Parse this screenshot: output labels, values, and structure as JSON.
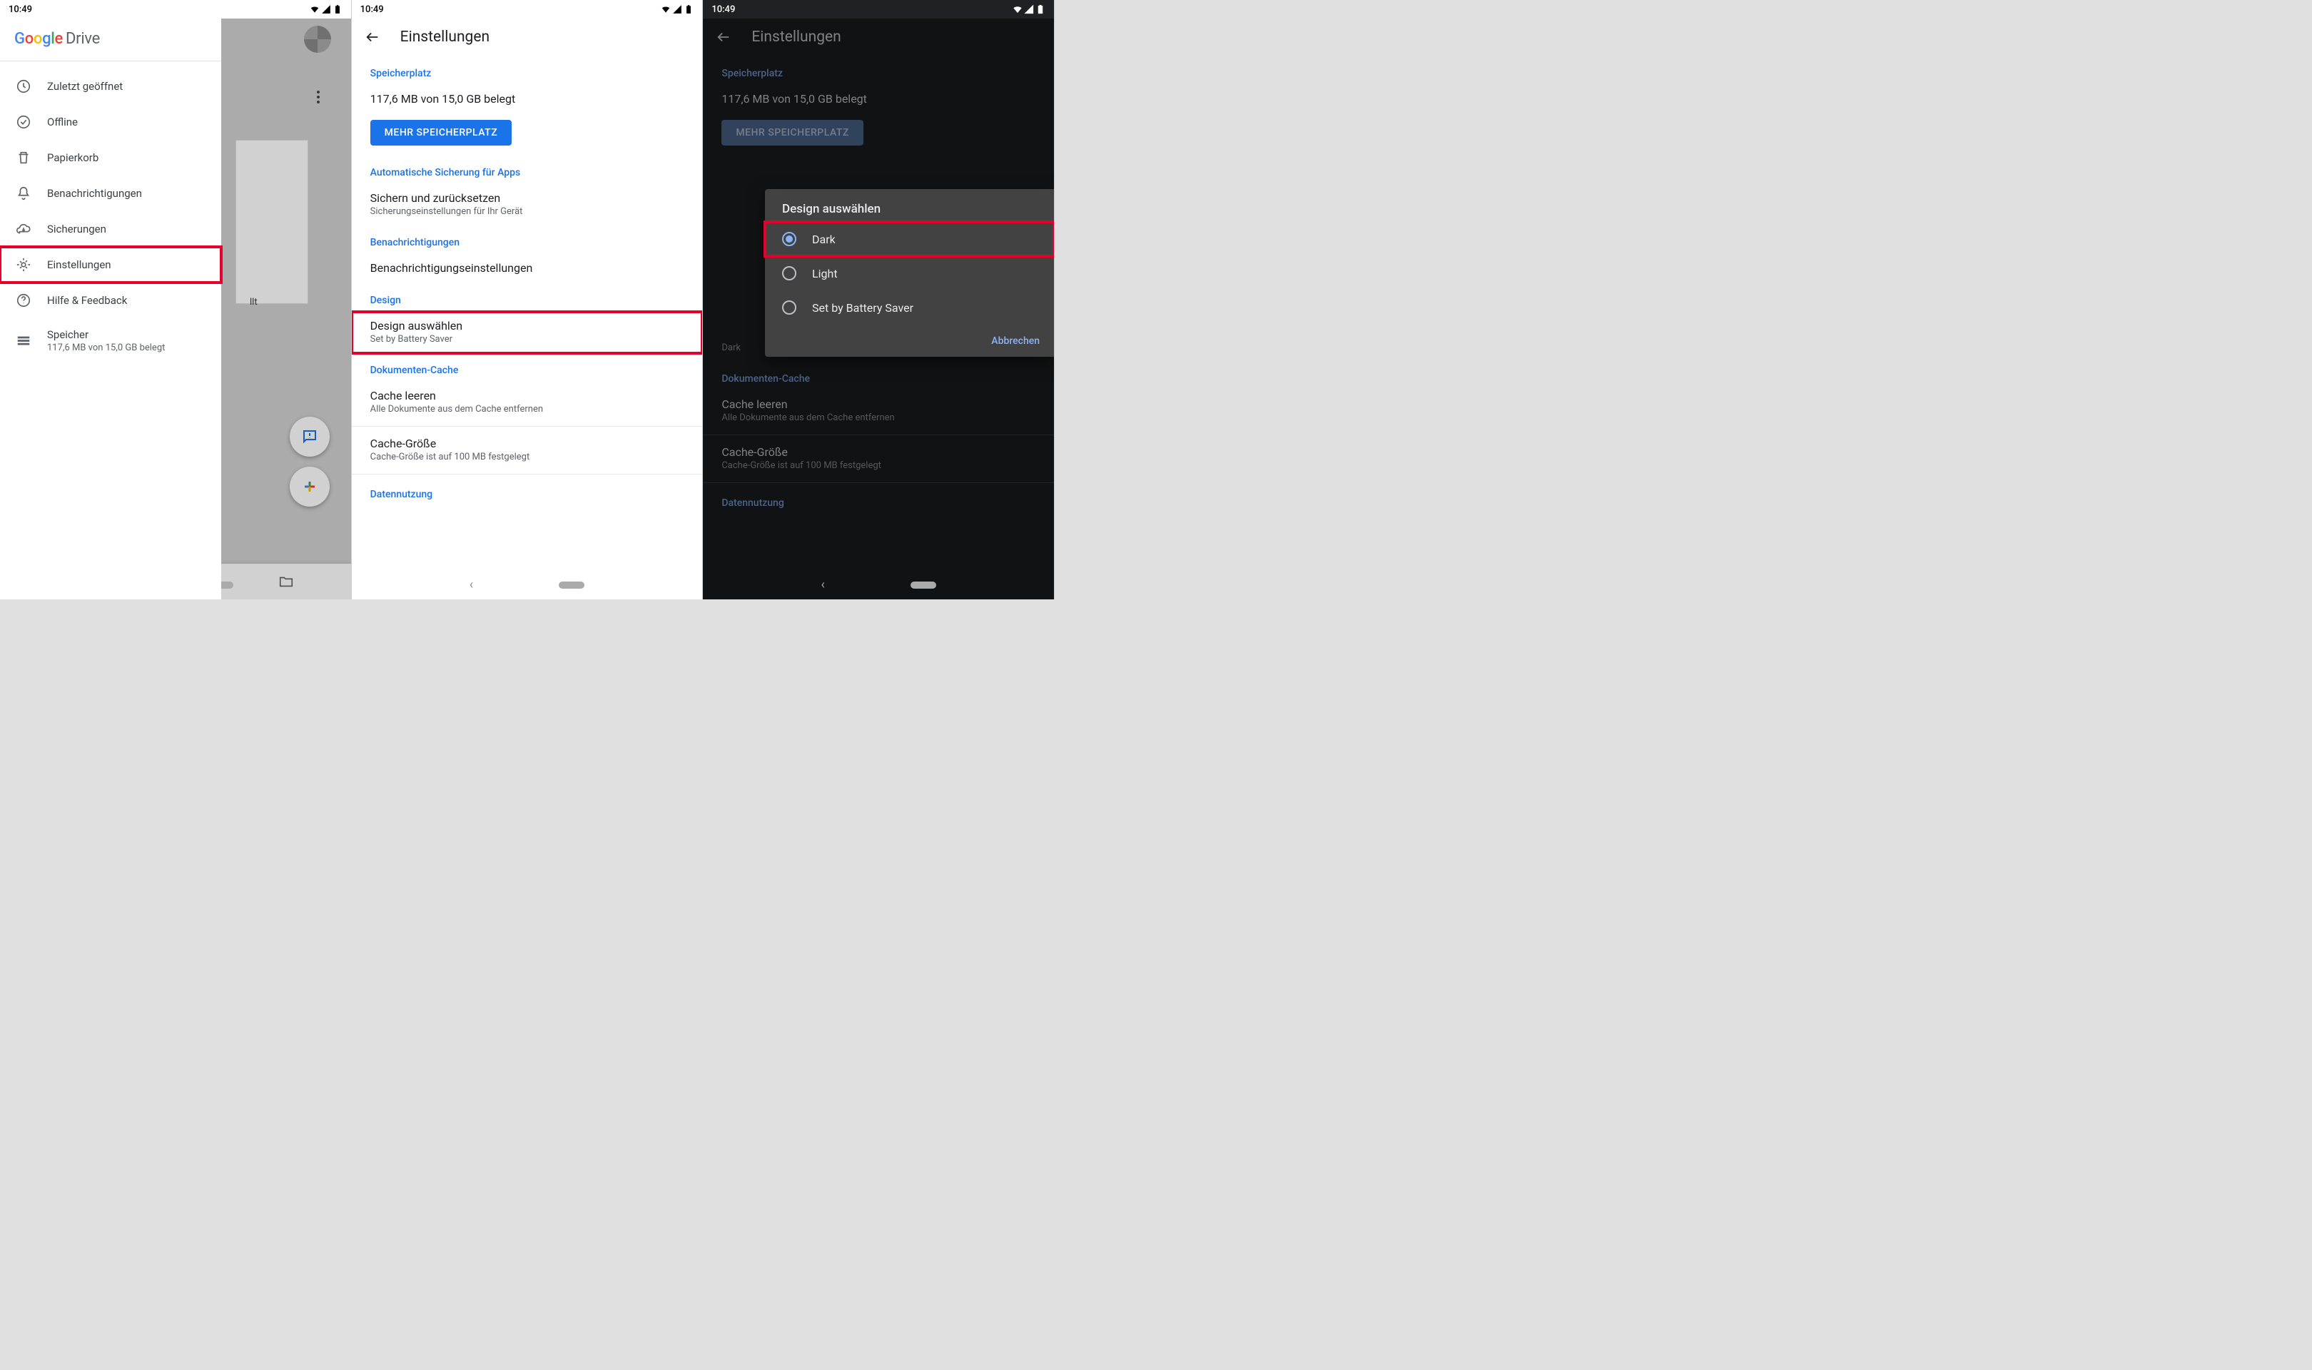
{
  "status": {
    "time": "10:49"
  },
  "screen1": {
    "brand_drive": "Drive",
    "menu": {
      "recent": "Zuletzt geöffnet",
      "offline": "Offline",
      "trash": "Papierkorb",
      "notifications": "Benachrichtigungen",
      "backups": "Sicherungen",
      "settings": "Einstellungen",
      "help": "Hilfe & Feedback",
      "storage": "Speicher",
      "storage_sub": "117,6 MB von 15,0 GB belegt"
    },
    "bg_filename": "llt"
  },
  "screen2": {
    "title": "Einstellungen",
    "storage_header": "Speicherplatz",
    "storage_text": "117,6 MB von 15,0 GB belegt",
    "storage_button": "MEHR SPEICHERPLATZ",
    "backup_header": "Automatische Sicherung für Apps",
    "backup_title": "Sichern und zurücksetzen",
    "backup_sub": "Sicherungseinstellungen für Ihr Gerät",
    "notif_header": "Benachrichtigungen",
    "notif_title": "Benachrichtigungseinstellungen",
    "design_header": "Design",
    "design_title": "Design auswählen",
    "design_sub": "Set by Battery Saver",
    "cache_header": "Dokumenten-Cache",
    "cache_clear": "Cache leeren",
    "cache_clear_sub": "Alle Dokumente aus dem Cache entfernen",
    "cache_size": "Cache-Größe",
    "cache_size_sub": "Cache-Größe ist auf 100 MB festgelegt",
    "data_header": "Datennutzung"
  },
  "screen3": {
    "title": "Einstellungen",
    "storage_header": "Speicherplatz",
    "storage_text": "117,6 MB von 15,0 GB belegt",
    "storage_button": "MEHR SPEICHERPLATZ",
    "design_sub": "Dark",
    "cache_header": "Dokumenten-Cache",
    "cache_clear": "Cache leeren",
    "cache_clear_sub": "Alle Dokumente aus dem Cache entfernen",
    "cache_size": "Cache-Größe",
    "cache_size_sub": "Cache-Größe ist auf 100 MB festgelegt",
    "data_header": "Datennutzung",
    "dialog": {
      "title": "Design auswählen",
      "dark": "Dark",
      "light": "Light",
      "battery": "Set by Battery Saver",
      "cancel": "Abbrechen"
    }
  }
}
